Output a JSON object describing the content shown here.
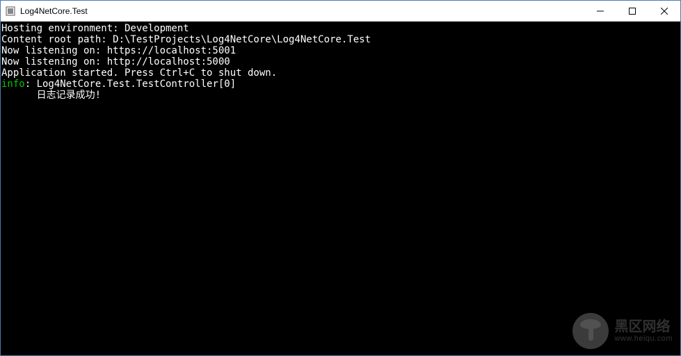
{
  "window": {
    "title": "Log4NetCore.Test"
  },
  "console": {
    "lines": [
      {
        "kind": "plain",
        "text": "Hosting environment: Development"
      },
      {
        "kind": "plain",
        "text": "Content root path: D:\\TestProjects\\Log4NetCore\\Log4NetCore.Test"
      },
      {
        "kind": "plain",
        "text": "Now listening on: https://localhost:5001"
      },
      {
        "kind": "plain",
        "text": "Now listening on: http://localhost:5000"
      },
      {
        "kind": "plain",
        "text": "Application started. Press Ctrl+C to shut down."
      },
      {
        "kind": "info",
        "prefix": "info",
        "rest": ": Log4NetCore.Test.TestController[0]"
      },
      {
        "kind": "plain",
        "text": "      日志记录成功!"
      }
    ]
  },
  "watermark": {
    "line1": "黑区网络",
    "line2": "www.heiqu.com"
  }
}
